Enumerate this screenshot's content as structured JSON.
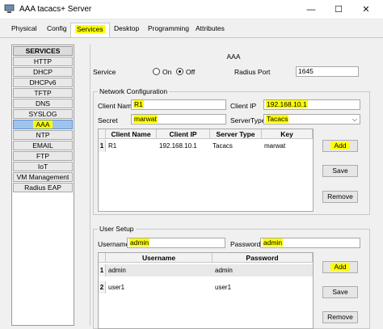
{
  "window": {
    "title": "AAA tacacs+ Server",
    "minimize": "—",
    "maximize": "☐",
    "close": "✕"
  },
  "tabs": [
    "Physical",
    "Config",
    "Services",
    "Desktop",
    "Programming",
    "Attributes"
  ],
  "sidebar": {
    "header": "SERVICES",
    "items": [
      "HTTP",
      "DHCP",
      "DHCPv6",
      "TFTP",
      "DNS",
      "SYSLOG",
      "AAA",
      "NTP",
      "EMAIL",
      "FTP",
      "IoT",
      "VM Management",
      "Radius EAP"
    ]
  },
  "aaa": {
    "title": "AAA",
    "service_label": "Service",
    "on_label": "On",
    "off_label": "Off",
    "radius_port_label": "Radius Port",
    "radius_port_value": "1645"
  },
  "network": {
    "title": "Network Configuration",
    "client_name_label": "Client Name",
    "client_name_value": "R1",
    "client_ip_label": "Client IP",
    "client_ip_value": "192.168.10.1",
    "secret_label": "Secret",
    "secret_value": "marwat",
    "server_type_label": "ServerType",
    "server_type_value": "Tacacs",
    "columns": [
      "Client Name",
      "Client IP",
      "Server Type",
      "Key"
    ],
    "rows": [
      {
        "index": "1",
        "name": "R1",
        "ip": "192.168.10.1",
        "type": "Tacacs",
        "key": "marwat"
      }
    ],
    "buttons": {
      "add": "Add",
      "save": "Save",
      "remove": "Remove"
    }
  },
  "users": {
    "title": "User Setup",
    "username_label": "Username",
    "username_value": "admin",
    "password_label": "Password",
    "password_value": "admin",
    "columns": [
      "Username",
      "Password"
    ],
    "rows": [
      {
        "index": "1",
        "username": "admin",
        "password": "admin"
      },
      {
        "index": "2",
        "username": "user1",
        "password": "user1"
      }
    ],
    "buttons": {
      "add": "Add",
      "save": "Save",
      "remove": "Remove"
    }
  },
  "colors": {
    "highlight": "#ffff00",
    "selected_sidebar": "#9ec4ec"
  }
}
